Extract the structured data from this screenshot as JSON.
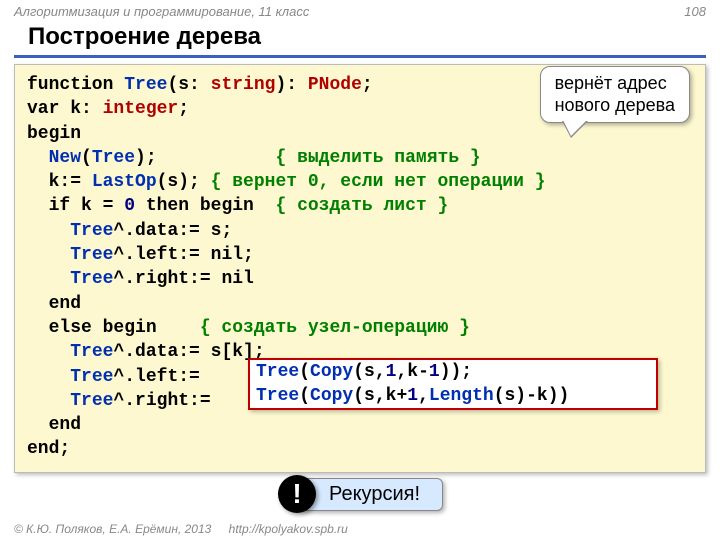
{
  "header": {
    "course": "Алгоритмизация и программирование, 11 класс",
    "page": "108"
  },
  "title": "Построение дерева",
  "callout_return": {
    "line1": "вернёт адрес",
    "line2": "нового дерева"
  },
  "recursion_label": "Рекурсия!",
  "exclaim": "!",
  "code": {
    "l1_a": "function ",
    "l1_b": "Tree",
    "l1_c": "(s: ",
    "l1_d": "string",
    "l1_e": "): ",
    "l1_f": "PNode",
    "l1_g": ";",
    "l2_a": "var k: ",
    "l2_b": "integer",
    "l2_c": ";",
    "l3": "begin",
    "l4_a": "  ",
    "l4_b": "New",
    "l4_c": "(",
    "l4_d": "Tree",
    "l4_e": ");           ",
    "l4_f": "{ выделить память }",
    "l5_a": "  k:= ",
    "l5_b": "LastOp",
    "l5_c": "(s); ",
    "l5_d": "{ вернет 0, если нет операции }",
    "l6_a": "  if k = ",
    "l6_b": "0",
    "l6_c": " then begin  ",
    "l6_d": "{ создать лист }",
    "l7_a": "    ",
    "l7_b": "Tree",
    "l7_c": "^.data:= s;",
    "l8_a": "    ",
    "l8_b": "Tree",
    "l8_c": "^.left:= nil;",
    "l9_a": "    ",
    "l9_b": "Tree",
    "l9_c": "^.right:= nil",
    "l10": "  end",
    "l11_a": "  else begin    ",
    "l11_b": "{ создать узел-операцию }",
    "l12_a": "    ",
    "l12_b": "Tree",
    "l12_c": "^.data:= s[k];",
    "l13_a": "    ",
    "l13_b": "Tree",
    "l13_c": "^.left:= ",
    "l14_a": "    ",
    "l14_b": "Tree",
    "l14_c": "^.right:= ",
    "l15": "  end",
    "l16": "end;"
  },
  "hl": {
    "h1_a": "Tree",
    "h1_b": "(",
    "h1_c": "Copy",
    "h1_d": "(s,",
    "h1_e": "1",
    "h1_f": ",k-",
    "h1_g": "1",
    "h1_h": "));",
    "h2_a": "Tree",
    "h2_b": "(",
    "h2_c": "Copy",
    "h2_d": "(s,k+",
    "h2_e": "1",
    "h2_f": ",",
    "h2_g": "Length",
    "h2_h": "(s)-k))"
  },
  "footer": {
    "copyright": "© К.Ю. Поляков, Е.А. Ерёмин, 2013",
    "url": "http://kpolyakov.spb.ru"
  }
}
